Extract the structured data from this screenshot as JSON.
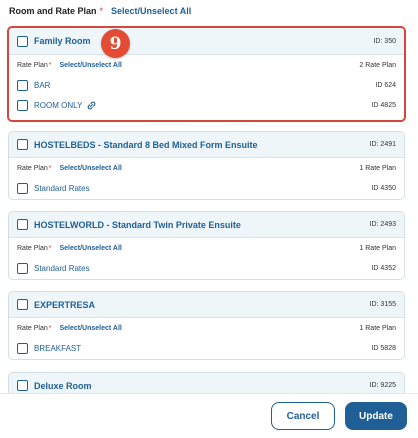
{
  "header": {
    "title": "Room and Rate Plan",
    "required_mark": "*",
    "select_all": "Select/Unselect All"
  },
  "rooms": [
    {
      "name": "Family Room",
      "id": "ID: 350",
      "rate_plan_label": "Rate Plan",
      "rate_plan_select": "Select/Unselect All",
      "rate_plan_count": "2 Rate Plan",
      "rates": [
        {
          "name": "BAR",
          "id": "ID 624"
        },
        {
          "name": "ROOM ONLY",
          "id": "ID 4825",
          "icon": "link-icon"
        }
      ]
    },
    {
      "name": "HOSTELBEDS - Standard 8 Bed Mixed Form Ensuite",
      "id": "ID: 2491",
      "rate_plan_label": "Rate Plan",
      "rate_plan_select": "Select/Unselect All",
      "rate_plan_count": "1 Rate Plan",
      "rates": [
        {
          "name": "Standard Rates",
          "id": "ID 4350"
        }
      ]
    },
    {
      "name": "HOSTELWORLD - Standard Twin Private Ensuite",
      "id": "ID: 2493",
      "rate_plan_label": "Rate Plan",
      "rate_plan_select": "Select/Unselect All",
      "rate_plan_count": "1 Rate Plan",
      "rates": [
        {
          "name": "Standard Rates",
          "id": "ID 4352"
        }
      ]
    },
    {
      "name": "EXPERTRESA",
      "id": "ID: 3155",
      "rate_plan_label": "Rate Plan",
      "rate_plan_select": "Select/Unselect All",
      "rate_plan_count": "1 Rate Plan",
      "rates": [
        {
          "name": "BREAKFAST",
          "id": "ID 5828"
        }
      ]
    },
    {
      "name": "Deluxe Room",
      "id": "ID: 9225"
    }
  ],
  "badge": {
    "number": "9",
    "color": "#e34b34"
  },
  "footer": {
    "cancel_label": "Cancel",
    "update_label": "Update"
  },
  "colors": {
    "accent": "#1f5f95",
    "highlight_border": "#d5473c",
    "required": "#d03a2c"
  }
}
